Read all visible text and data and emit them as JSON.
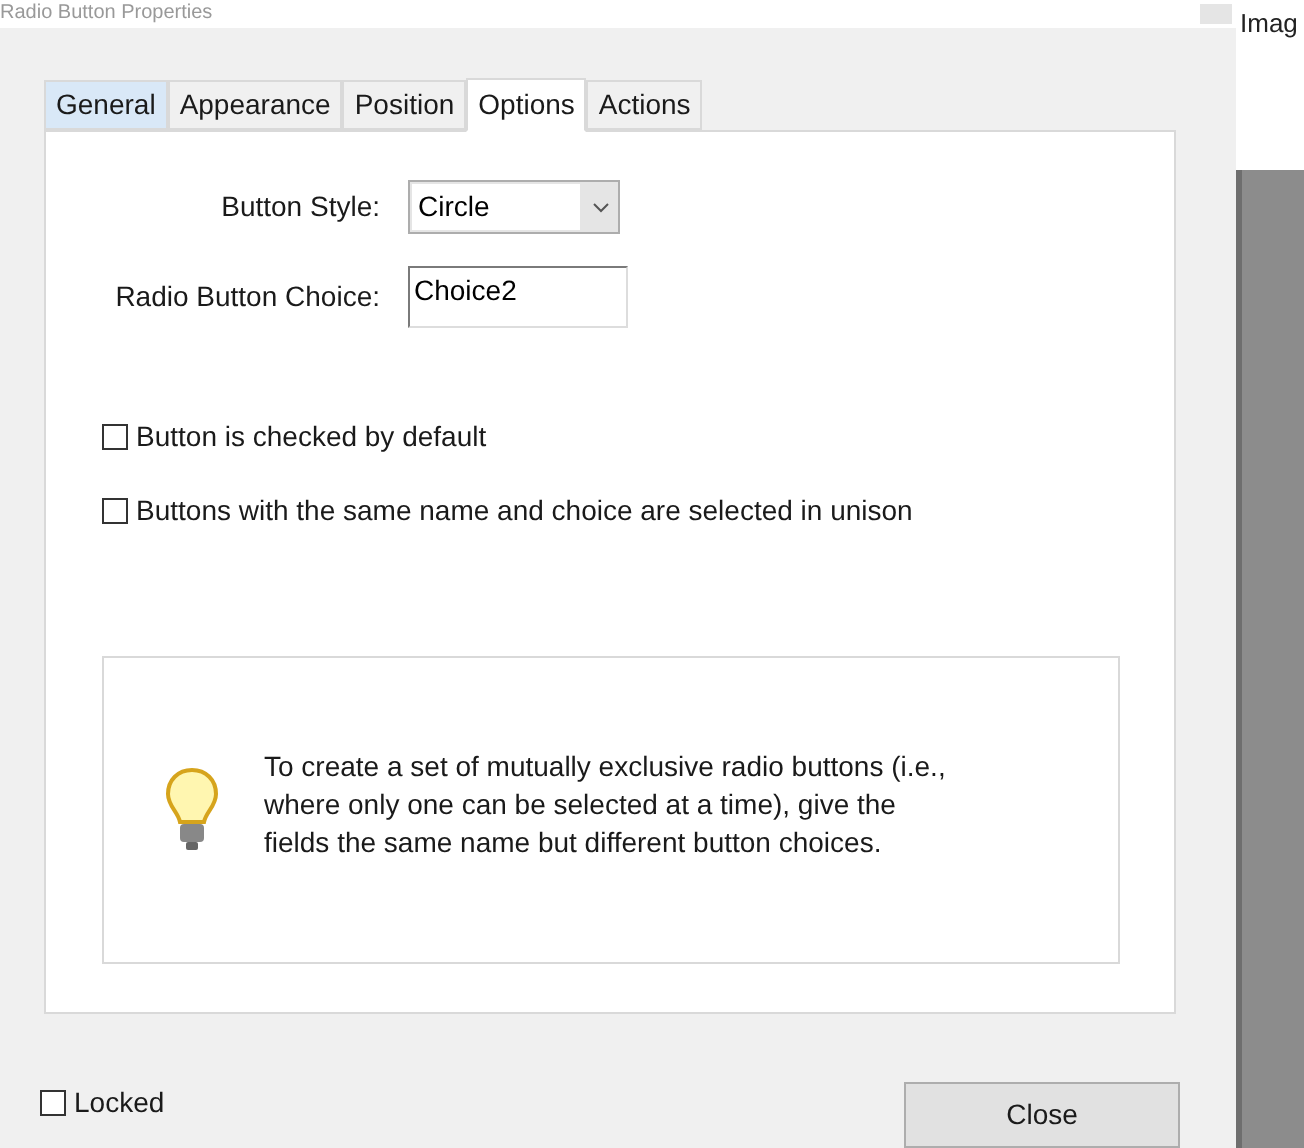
{
  "window": {
    "title": "Radio Button Properties"
  },
  "tabs": [
    {
      "label": "General",
      "selected": false,
      "highlighted": true
    },
    {
      "label": "Appearance",
      "selected": false,
      "highlighted": false
    },
    {
      "label": "Position",
      "selected": false,
      "highlighted": false
    },
    {
      "label": "Options",
      "selected": true,
      "highlighted": false
    },
    {
      "label": "Actions",
      "selected": false,
      "highlighted": false
    }
  ],
  "button_style": {
    "label": "Button Style:",
    "value": "Circle"
  },
  "radio_button_choice": {
    "label": "Radio Button Choice:",
    "value": "Choice2"
  },
  "checkboxes": [
    {
      "label": "Button is checked by default",
      "checked": false
    },
    {
      "label": "Buttons with the same name and choice are selected in unison",
      "checked": false
    }
  ],
  "tip": {
    "text": "To create a set of mutually exclusive radio buttons (i.e., where only one can be selected at a time), give the fields the same name but different button choices."
  },
  "locked": {
    "label": "Locked",
    "checked": false
  },
  "buttons": [
    "Close"
  ],
  "background_window": {
    "title": "Imag"
  }
}
